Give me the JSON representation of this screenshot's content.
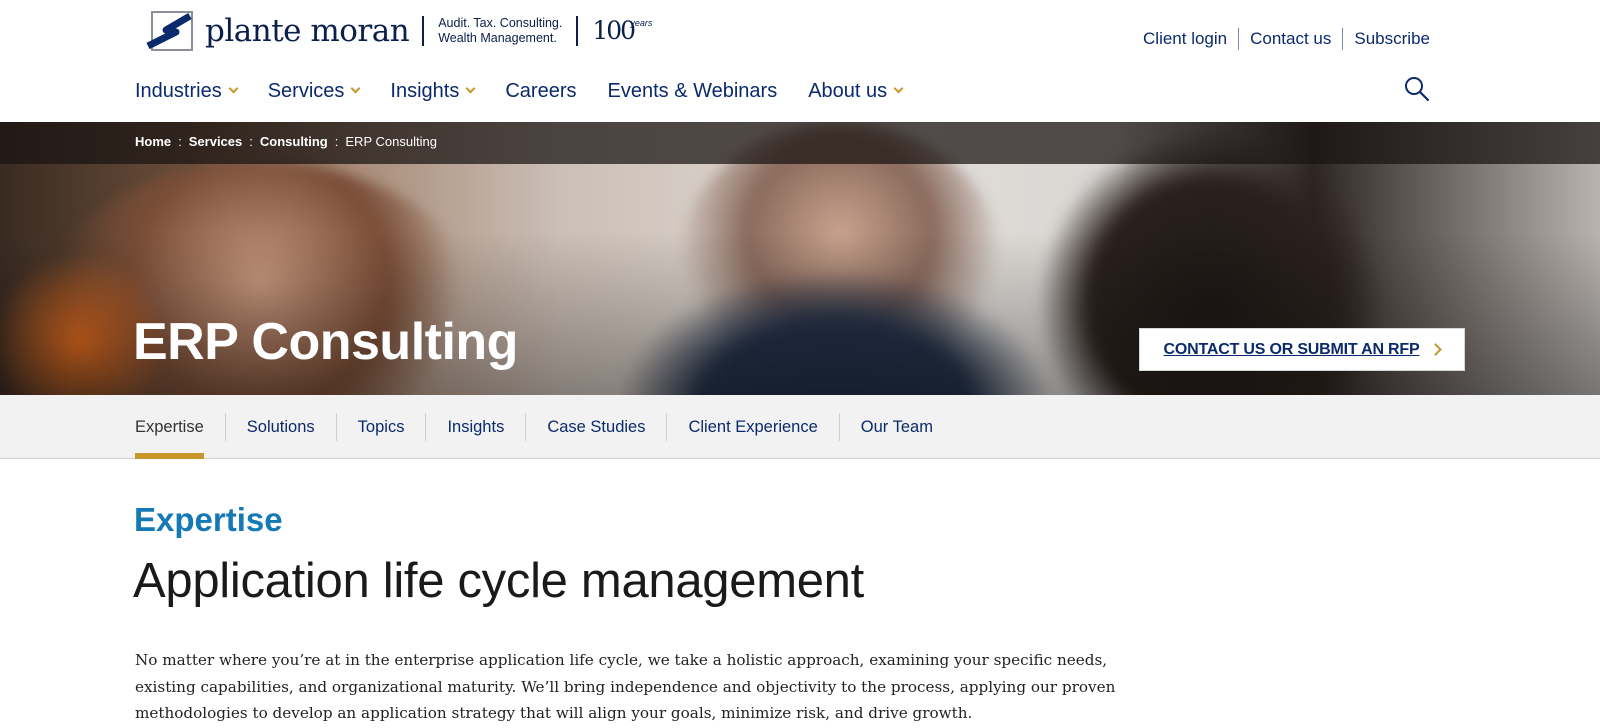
{
  "brand": {
    "name": "plante moran",
    "tagline_line1": "Audit. Tax. Consulting.",
    "tagline_line2": "Wealth Management.",
    "anniversary_number": "100",
    "anniversary_word": "years",
    "colors": {
      "navy": "#0b2a6b",
      "gold": "#c8962b",
      "blue": "#1479b5"
    }
  },
  "utility_nav": {
    "client_login": "Client login",
    "contact_us": "Contact us",
    "subscribe": "Subscribe"
  },
  "main_nav": [
    {
      "label": "Industries",
      "dropdown": true
    },
    {
      "label": "Services",
      "dropdown": true
    },
    {
      "label": "Insights",
      "dropdown": true
    },
    {
      "label": "Careers",
      "dropdown": false
    },
    {
      "label": "Events & Webinars",
      "dropdown": false
    },
    {
      "label": "About us",
      "dropdown": true
    }
  ],
  "search_icon": "search-icon",
  "breadcrumb": {
    "items": [
      "Home",
      "Services",
      "Consulting",
      "ERP Consulting"
    ],
    "separator": ":"
  },
  "hero": {
    "title": "ERP Consulting",
    "cta_label": "CONTACT US OR SUBMIT AN RFP"
  },
  "tabs": [
    {
      "label": "Expertise",
      "active": true
    },
    {
      "label": "Solutions",
      "active": false
    },
    {
      "label": "Topics",
      "active": false
    },
    {
      "label": "Insights",
      "active": false
    },
    {
      "label": "Case Studies",
      "active": false
    },
    {
      "label": "Client Experience",
      "active": false
    },
    {
      "label": "Our Team",
      "active": false
    }
  ],
  "content": {
    "eyebrow": "Expertise",
    "headline": "Application life cycle management",
    "body": "No matter where you’re at in the enterprise application life cycle, we take a holistic approach, examining your specific needs, existing capabilities, and organizational maturity. We’ll bring independence and objectivity to the process, applying our proven methodologies to develop an application strategy that will align your goals, minimize risk, and drive growth."
  }
}
